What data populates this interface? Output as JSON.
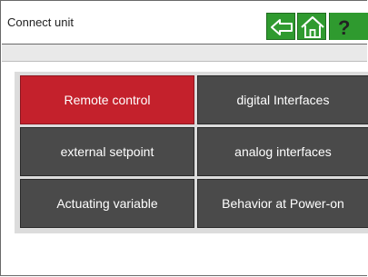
{
  "header": {
    "title": "Connect unit",
    "back_icon": "back-arrow-icon",
    "home_icon": "home-icon",
    "help_icon": "help-icon"
  },
  "colors": {
    "active_tile": "#c4212c",
    "tile": "#4a4a4a",
    "nav_button": "#2f9a2f"
  },
  "menu": {
    "items": [
      {
        "label": "Remote control",
        "selected": true
      },
      {
        "label": "digital Interfaces",
        "selected": false
      },
      {
        "label": "external setpoint",
        "selected": false
      },
      {
        "label": "analog interfaces",
        "selected": false
      },
      {
        "label": "Actuating variable",
        "selected": false
      },
      {
        "label": "Behavior at Power-on",
        "selected": false
      }
    ]
  }
}
